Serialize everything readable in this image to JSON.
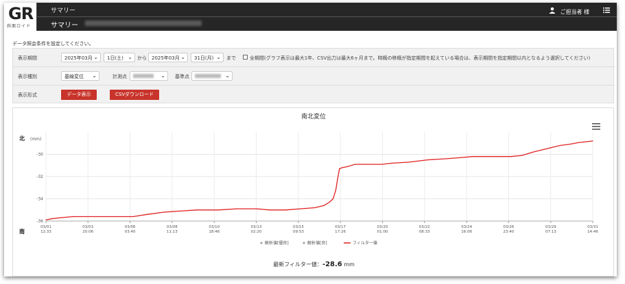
{
  "logo": {
    "text": "GR",
    "sub": "斜面ロイド"
  },
  "nav": {
    "top": "サマリー",
    "current": "サマリー"
  },
  "user": {
    "name": "ご担当者 様"
  },
  "hint": "データ照会条件を設定してください。",
  "form": {
    "period_label": "表示期間",
    "start_month": "2025年03月",
    "start_day": "1日(土)",
    "from": "から",
    "end_month": "2025年03月",
    "end_day": "31日(月)",
    "until": "まで",
    "all_period": "全期間(グラフ表示は最大1年、CSV出力は最大6ヶ月まで。時概の移概が指定期間を起えている場合は、表示期間を指定期間以内となるよう選択してください)",
    "type_label": "表示種別",
    "type_value": "基線変位",
    "point_label": "計測点",
    "base_label": "基準点",
    "format_label": "表示形式",
    "data_button": "データ表示",
    "csv_button": "CSVダウンロード"
  },
  "chart_data": {
    "type": "line",
    "title": "南北変位",
    "ylabel": "(mm)",
    "y_top_label": "北",
    "y_bottom_label": "南",
    "ylim": [
      -36,
      -28
    ],
    "yticks": [
      -30,
      -32,
      -34,
      -36
    ],
    "xticks": [
      {
        "date": "03/01",
        "time": "12:33",
        "x": 0
      },
      {
        "date": "03/03",
        "time": "20:06",
        "x": 2.31
      },
      {
        "date": "03/06",
        "time": "03:40",
        "x": 4.63
      },
      {
        "date": "03/08",
        "time": "11:13",
        "x": 6.94
      },
      {
        "date": "03/10",
        "time": "18:46",
        "x": 9.26
      },
      {
        "date": "03/13",
        "time": "02:20",
        "x": 11.57
      },
      {
        "date": "03/15",
        "time": "09:53",
        "x": 13.89
      },
      {
        "date": "03/17",
        "time": "17:26",
        "x": 16.2
      },
      {
        "date": "03/20",
        "time": "01:00",
        "x": 18.52
      },
      {
        "date": "03/22",
        "time": "08:33",
        "x": 20.83
      },
      {
        "date": "03/24",
        "time": "16:06",
        "x": 23.15
      },
      {
        "date": "03/26",
        "time": "23:40",
        "x": 25.46
      },
      {
        "date": "03/29",
        "time": "07:13",
        "x": 27.78
      },
      {
        "date": "03/31",
        "time": "14:46",
        "x": 30.09
      }
    ],
    "series": [
      {
        "name": "フィルター値",
        "color": "#e02020",
        "x": [
          0,
          0.3,
          0.8,
          1.5,
          3,
          4.8,
          5.6,
          6.5,
          7.4,
          8.3,
          9.5,
          10.5,
          11.6,
          12.3,
          13.2,
          14,
          14.8,
          15.3,
          15.6,
          15.8,
          15.95,
          16.05,
          16.15,
          16.3,
          16.6,
          17,
          17.6,
          18.5,
          19,
          20,
          21,
          22,
          22.8,
          23.5,
          25,
          25.6,
          26.2,
          26.8,
          27.3,
          27.8,
          28.3,
          28.8,
          29.3,
          30.09
        ],
        "y": [
          -35.9,
          -35.8,
          -35.7,
          -35.6,
          -35.6,
          -35.6,
          -35.4,
          -35.2,
          -35.1,
          -35,
          -35,
          -34.9,
          -34.9,
          -35,
          -35,
          -34.9,
          -34.8,
          -34.6,
          -34.3,
          -34,
          -33.2,
          -32.2,
          -31.3,
          -31.2,
          -31.1,
          -30.9,
          -30.9,
          -30.9,
          -30.8,
          -30.7,
          -30.5,
          -30.4,
          -30.3,
          -30.2,
          -30.2,
          -30.2,
          -30.1,
          -29.8,
          -29.6,
          -29.4,
          -29.2,
          -29.1,
          -28.95,
          -28.8
        ]
      }
    ],
    "legend": [
      {
        "label": "解析値[優良]",
        "kind": "dot",
        "color": "#999999"
      },
      {
        "label": "解析値[良]",
        "kind": "dot",
        "color": "#999999"
      },
      {
        "label": "フィルター値",
        "kind": "line",
        "color": "#e02020"
      }
    ],
    "legend_position": "bottom",
    "grid": true
  },
  "footer": {
    "label": "最新フィルター値：",
    "value": "-28.6",
    "unit": "mm"
  }
}
